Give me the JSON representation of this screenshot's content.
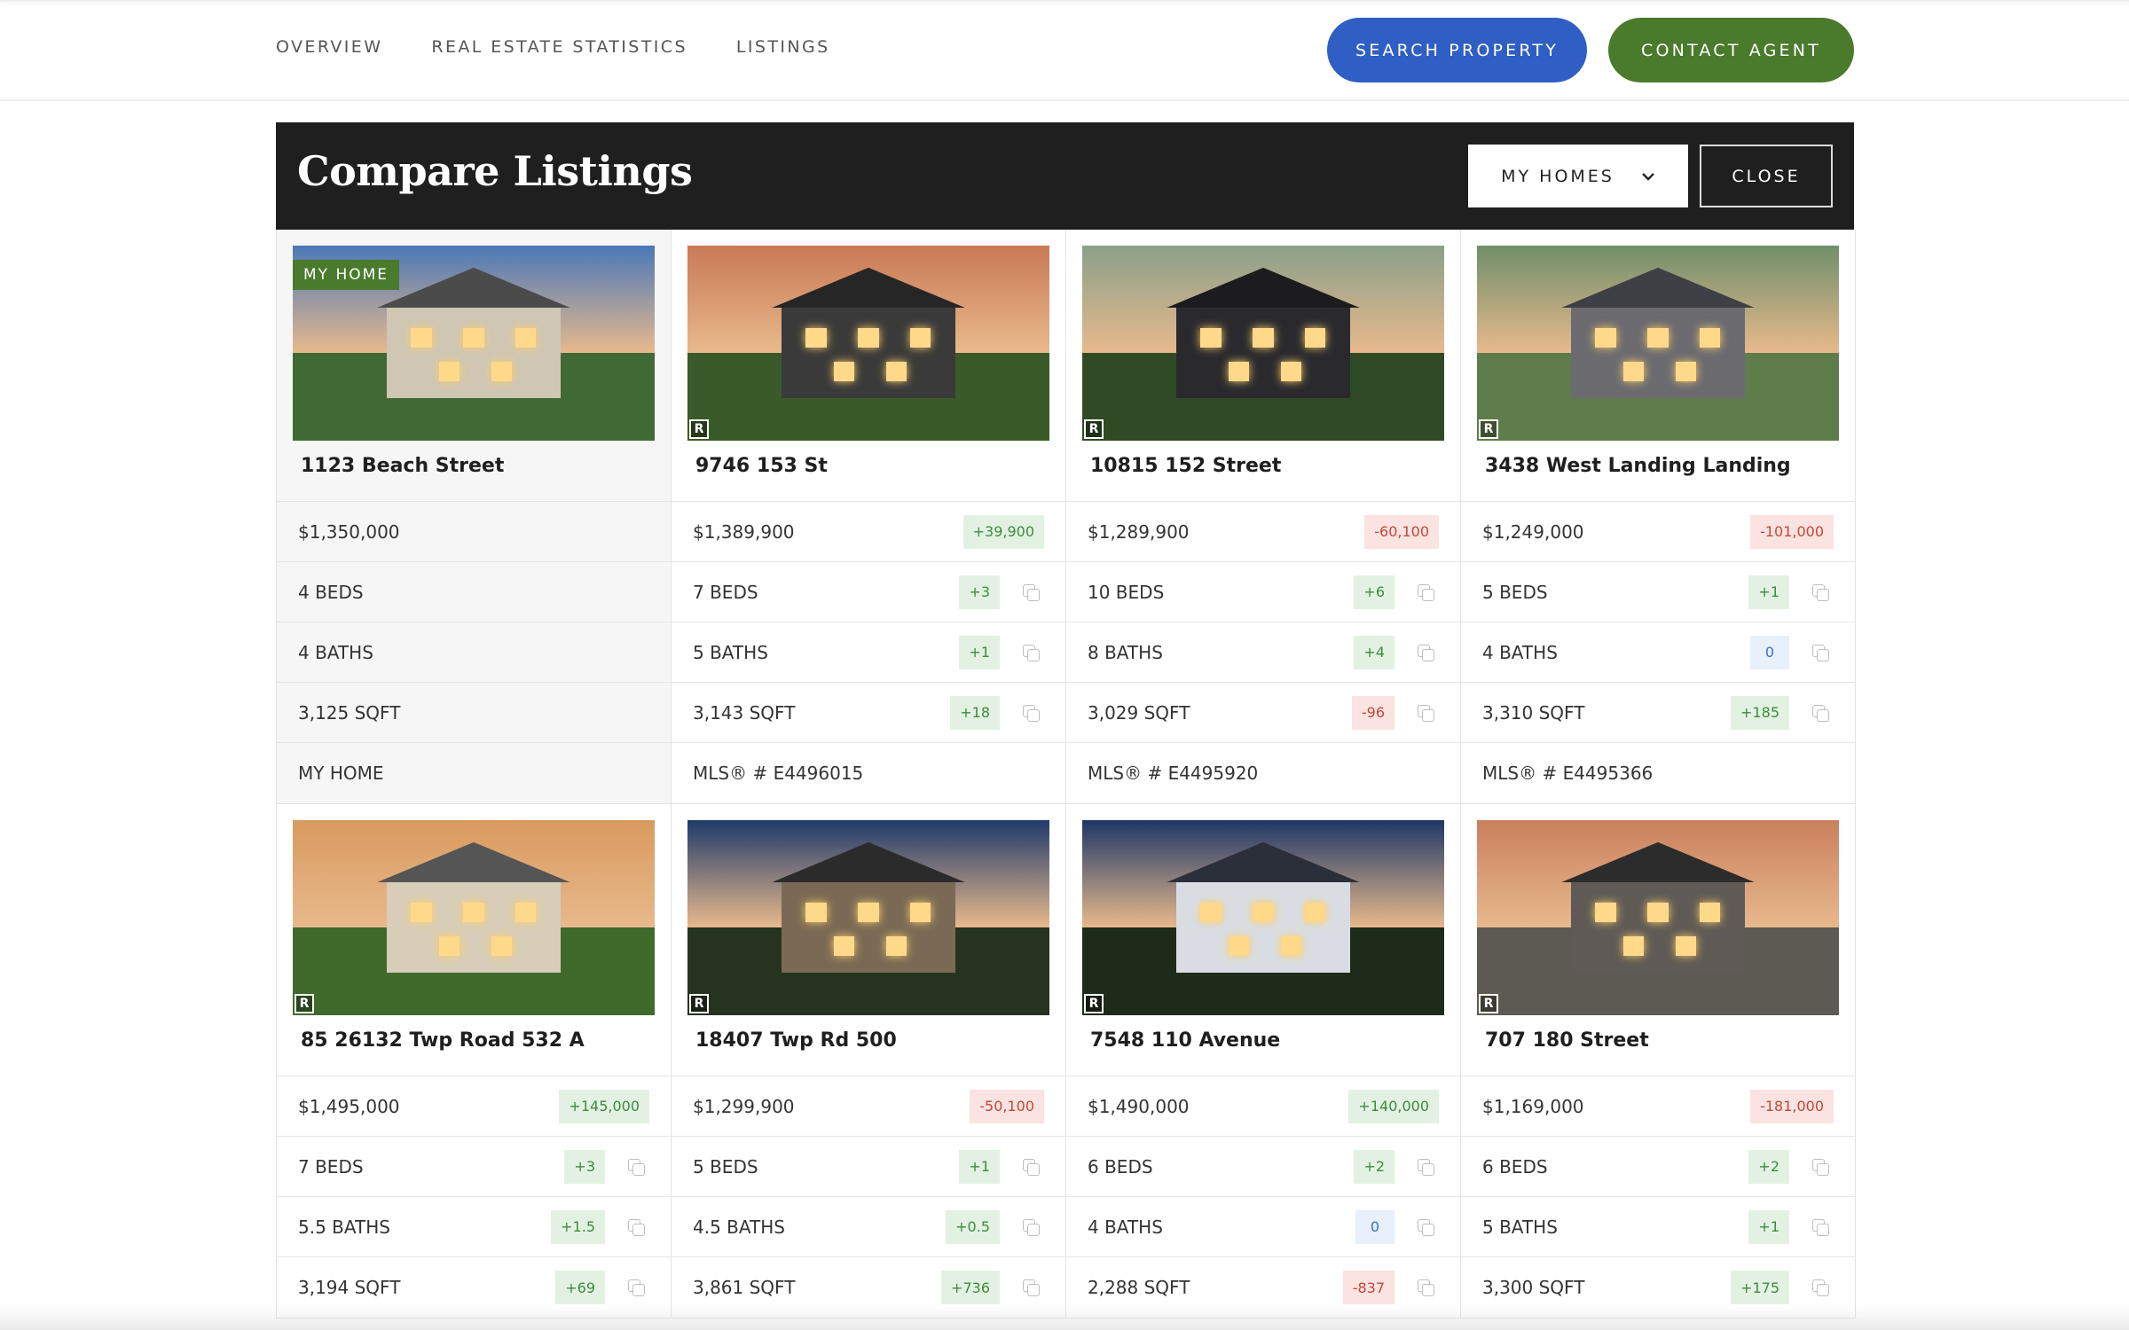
{
  "nav": {
    "items": [
      "OVERVIEW",
      "REAL ESTATE STATISTICS",
      "LISTINGS"
    ],
    "search_label": "SEARCH PROPERTY",
    "contact_label": "CONTACT AGENT"
  },
  "compare": {
    "title": "Compare Listings",
    "filter_selected": "MY HOMES",
    "close_label": "CLOSE"
  },
  "badge_my_home": "MY HOME",
  "mls_mark": "R",
  "listings": [
    {
      "address": "1123 Beach Street",
      "mine": true,
      "price": "$1,350,000",
      "price_diff": null,
      "beds": "4 BEDS",
      "beds_diff": null,
      "baths": "4 BATHS",
      "baths_diff": null,
      "sqft": "3,125 SQFT",
      "sqft_diff": null,
      "footer": "MY HOME",
      "photo": {
        "sky": "#4a78b8",
        "land": "#3f6a33",
        "house": "#cfc6b4",
        "roof": "#4b4b4b"
      }
    },
    {
      "address": "9746 153 St",
      "mine": false,
      "price": "$1,389,900",
      "price_diff": "+39,900",
      "beds": "7 BEDS",
      "beds_diff": "+3",
      "baths": "5 BATHS",
      "baths_diff": "+1",
      "sqft": "3,143 SQFT",
      "sqft_diff": "+18",
      "footer": "MLS® # E4496015",
      "photo": {
        "sky": "#c97955",
        "land": "#3b5a2a",
        "house": "#3a3a3a",
        "roof": "#262626"
      }
    },
    {
      "address": "10815 152 Street",
      "mine": false,
      "price": "$1,289,900",
      "price_diff": "-60,100",
      "beds": "10 BEDS",
      "beds_diff": "+6",
      "baths": "8 BATHS",
      "baths_diff": "+4",
      "sqft": "3,029 SQFT",
      "sqft_diff": "-96",
      "footer": "MLS® # E4495920",
      "photo": {
        "sky": "#8aa08a",
        "land": "#2f4a25",
        "house": "#2a2a2e",
        "roof": "#1c1c1f"
      }
    },
    {
      "address": "3438 West Landing Landing",
      "mine": false,
      "price": "$1,249,000",
      "price_diff": "-101,000",
      "beds": "5 BEDS",
      "beds_diff": "+1",
      "baths": "4 BATHS",
      "baths_diff": "0",
      "sqft": "3,310 SQFT",
      "sqft_diff": "+185",
      "footer": "MLS® # E4495366",
      "photo": {
        "sky": "#6f8f6a",
        "land": "#5e7d4a",
        "house": "#6b6b70",
        "roof": "#3f3f46"
      }
    },
    {
      "address": "85 26132 Twp Road 532 A",
      "mine": false,
      "price": "$1,495,000",
      "price_diff": "+145,000",
      "beds": "7 BEDS",
      "beds_diff": "+3",
      "baths": "5.5 BATHS",
      "baths_diff": "+1.5",
      "sqft": "3,194 SQFT",
      "sqft_diff": "+69",
      "footer": "",
      "photo": {
        "sky": "#d99a5e",
        "land": "#3f6a2c",
        "house": "#d8cdb8",
        "roof": "#555"
      }
    },
    {
      "address": "18407 Twp Rd 500",
      "mine": false,
      "price": "$1,299,900",
      "price_diff": "-50,100",
      "beds": "5 BEDS",
      "beds_diff": "+1",
      "baths": "4.5 BATHS",
      "baths_diff": "+0.5",
      "sqft": "3,861 SQFT",
      "sqft_diff": "+736",
      "footer": "",
      "photo": {
        "sky": "#1f3a6b",
        "land": "#26331e",
        "house": "#7a6a55",
        "roof": "#2b2b2b"
      }
    },
    {
      "address": "7548 110 Avenue",
      "mine": false,
      "price": "$1,490,000",
      "price_diff": "+140,000",
      "beds": "6 BEDS",
      "beds_diff": "+2",
      "baths": "4 BATHS",
      "baths_diff": "0",
      "sqft": "2,288 SQFT",
      "sqft_diff": "-837",
      "footer": "",
      "photo": {
        "sky": "#1d3766",
        "land": "#1f2b1a",
        "house": "#d9dde3",
        "roof": "#2b2f3a"
      }
    },
    {
      "address": "707 180 Street",
      "mine": false,
      "price": "$1,169,000",
      "price_diff": "-181,000",
      "beds": "6 BEDS",
      "beds_diff": "+2",
      "baths": "5 BATHS",
      "baths_diff": "+1",
      "sqft": "3,300 SQFT",
      "sqft_diff": "+175",
      "footer": "",
      "photo": {
        "sky": "#c9805d",
        "land": "#5c5a52",
        "house": "#5f5a55",
        "roof": "#2c2c2c"
      }
    }
  ]
}
